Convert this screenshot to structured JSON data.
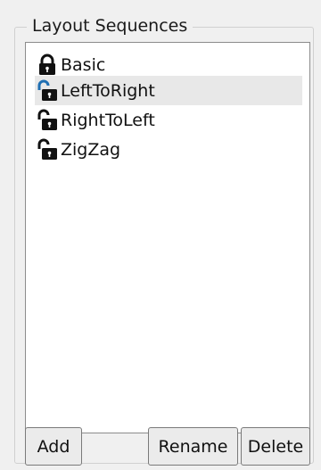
{
  "group": {
    "title": "Layout Sequences"
  },
  "list": {
    "items": [
      {
        "label": "Basic",
        "icon": "lock-closed-icon",
        "selected": false
      },
      {
        "label": "LeftToRight",
        "icon": "lock-open-icon",
        "selected": true
      },
      {
        "label": "RightToLeft",
        "icon": "lock-open-icon",
        "selected": false
      },
      {
        "label": "ZigZag",
        "icon": "lock-open-icon",
        "selected": false
      }
    ]
  },
  "buttons": {
    "add_label": "Add",
    "rename_label": "Rename",
    "delete_label": "Delete"
  },
  "colors": {
    "selection": "#e8e8e8",
    "lock_body": "#111111",
    "lock_keyhole": "#ffffff",
    "open_shackle": "#1f6fb3"
  }
}
